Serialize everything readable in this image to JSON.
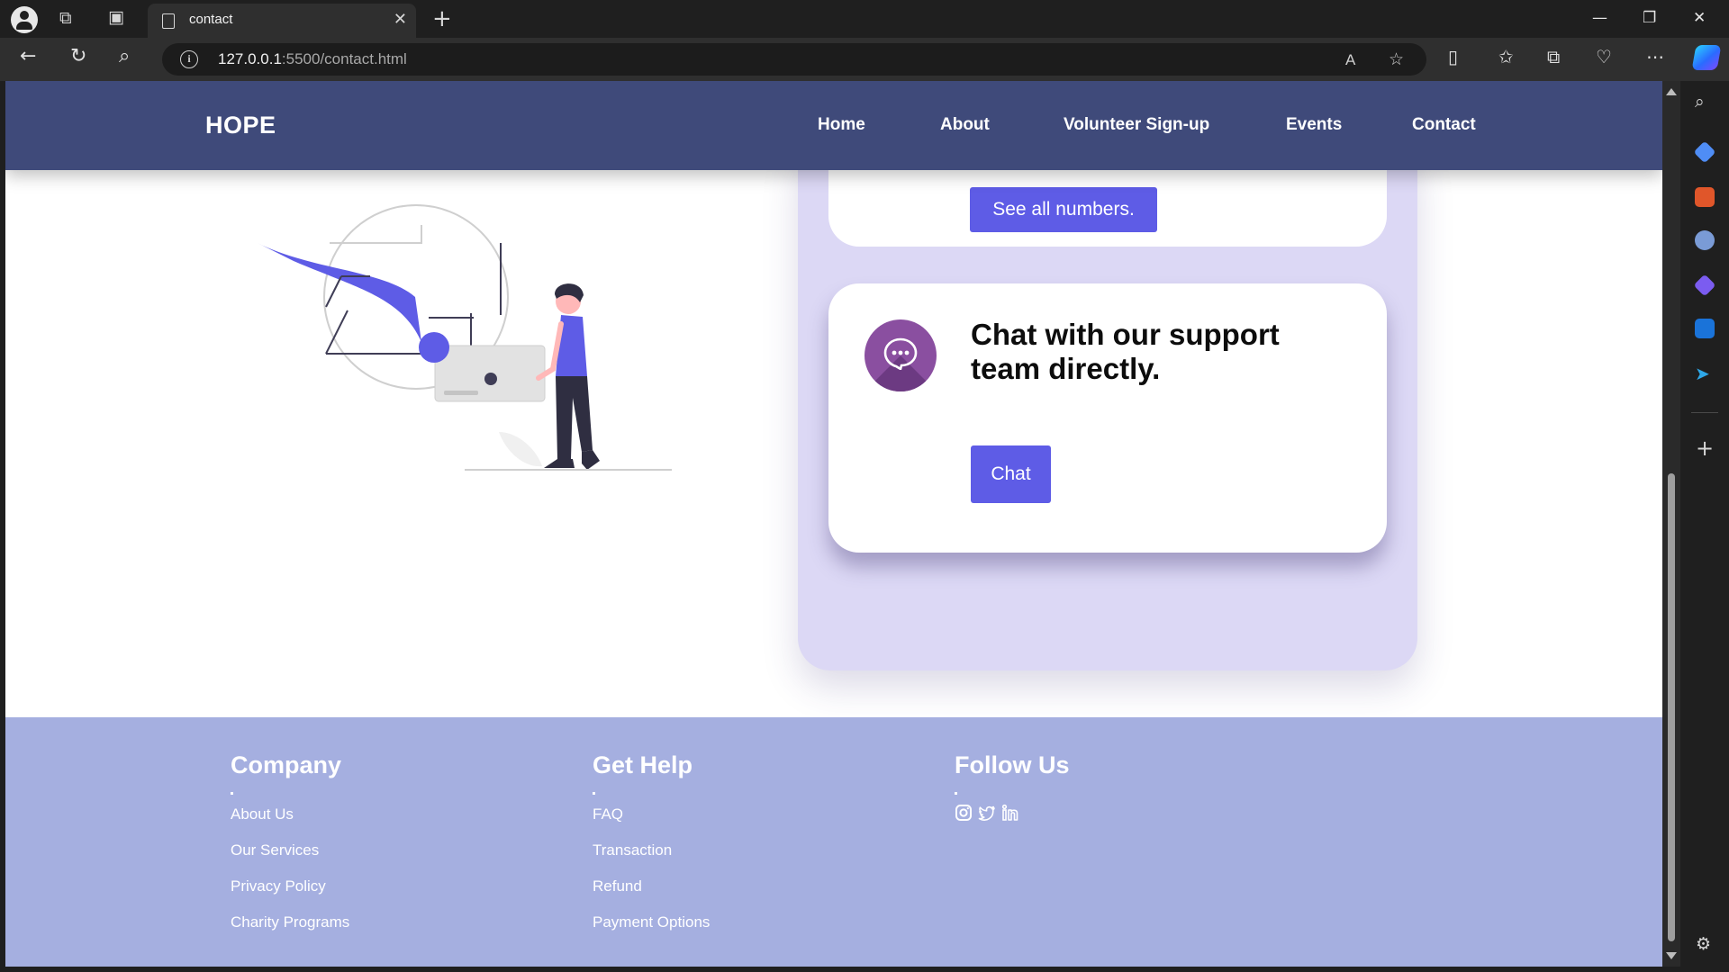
{
  "browser": {
    "tab_title": "contact",
    "url_host": "127.0.0.1",
    "url_path": ":5500/contact.html",
    "colors": {
      "chrome_bg": "#1f1f1f",
      "addr_bg": "#2f2f2f"
    }
  },
  "nav": {
    "brand": "HOPE",
    "links": [
      "Home",
      "About",
      "Volunteer Sign-up",
      "Events",
      "Contact"
    ],
    "color": "#3f4a7a"
  },
  "contact": {
    "see_all_button": "See all numbers.",
    "chat_title": "Chat with our support team directly.",
    "chat_button": "Chat",
    "accent": "#5e5ce6",
    "panel_color": "#dcd8f5"
  },
  "footer": {
    "color": "#a5afe0",
    "columns": [
      {
        "heading": "Company",
        "links": [
          "About Us",
          "Our Services",
          "Privacy Policy",
          "Charity Programs"
        ]
      },
      {
        "heading": "Get Help",
        "links": [
          "FAQ",
          "Transaction",
          "Refund",
          "Payment Options"
        ]
      },
      {
        "heading": "Follow Us",
        "social": [
          "instagram-icon",
          "twitter-icon",
          "linkedin-icon"
        ]
      }
    ]
  }
}
